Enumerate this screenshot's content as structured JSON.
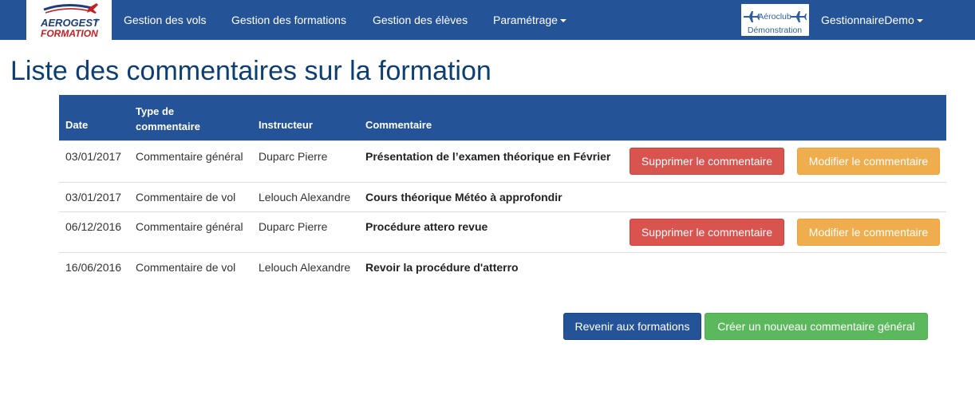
{
  "brand": {
    "logo_line1": "AEROGEST",
    "logo_line2": "FORMATION",
    "logo_mark": "®"
  },
  "nav": {
    "items": [
      {
        "label": "Gestion des vols"
      },
      {
        "label": "Gestion des formations"
      },
      {
        "label": "Gestion des élèves"
      },
      {
        "label": "Paramétrage"
      }
    ],
    "club_badge": {
      "line1": "Aéroclub",
      "line2": "Démonstration"
    },
    "user": "GestionnaireDemo"
  },
  "page": {
    "title": "Liste des commentaires sur la formation"
  },
  "table": {
    "headers": {
      "date": "Date",
      "type_line1": "Type de",
      "type_line2": "commentaire",
      "instructor": "Instructeur",
      "comment": "Commentaire"
    },
    "rows": [
      {
        "date": "03/01/2017",
        "type": "Commentaire général",
        "instructor": "Duparc Pierre",
        "comment": "Présentation de l’examen théorique en Février"
      },
      {
        "date": "03/01/2017",
        "type": "Commentaire de vol",
        "instructor": "Lelouch Alexandre",
        "comment": "Cours théorique Météo à approfondir"
      },
      {
        "date": "06/12/2016",
        "type": "Commentaire général",
        "instructor": "Duparc Pierre",
        "comment": "Procédure attero revue"
      },
      {
        "date": "16/06/2016",
        "type": "Commentaire de vol",
        "instructor": "Lelouch Alexandre",
        "comment": "Revoir la procédure d'atterro"
      }
    ],
    "delete_label": "Supprimer le commentaire",
    "edit_label": "Modifier le commentaire"
  },
  "footer_actions": {
    "back_label": "Revenir aux formations",
    "create_label": "Créer un nouveau commentaire général"
  },
  "colors": {
    "navbar": "#245497",
    "title": "#0d3e72",
    "danger": "#d9534f",
    "warning": "#f0ad4e",
    "success": "#5cb85c"
  },
  "icons": {
    "logo": "aerogest-logo",
    "plane": "airplane-icon",
    "caret": "caret-down-icon"
  }
}
